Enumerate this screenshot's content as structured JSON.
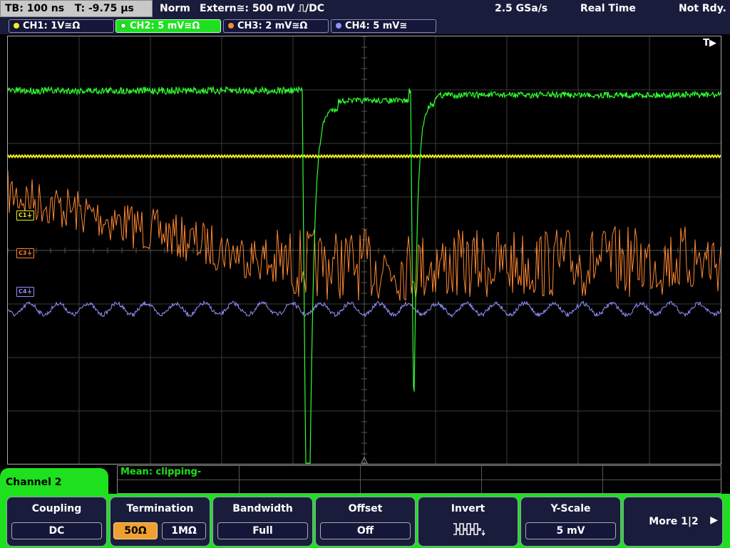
{
  "status": {
    "timebase": "TB: 100 ns",
    "trigger_time": "T: -9.75 µs",
    "mode": "Norm",
    "trigger_source": "Extern≅: 500 mV ⎍/DC",
    "sample_rate": "2.5 GSa/s",
    "acq_mode": "Real Time",
    "ready": "Not Rdy."
  },
  "channels": [
    {
      "label": "CH1: 1V≅Ω",
      "color": "#f0f020"
    },
    {
      "label": "CH2: 5 mV≅Ω",
      "color": "#30ff30"
    },
    {
      "label": "CH3: 2 mV≅Ω",
      "color": "#ff8830"
    },
    {
      "label": "CH4: 5 mV≅",
      "color": "#9090ff"
    }
  ],
  "markers": {
    "c1": "C1⏚",
    "c3": "C3⏚",
    "c4": "C4⏚",
    "trigger": "T▶"
  },
  "panel": {
    "title": "Channel 2",
    "mean": "Mean: clipping-"
  },
  "softkeys": {
    "coupling": {
      "title": "Coupling",
      "value": "DC"
    },
    "termination": {
      "title": "Termination",
      "opt1": "50Ω",
      "opt2": "1MΩ"
    },
    "bandwidth": {
      "title": "Bandwidth",
      "value": "Full"
    },
    "offset": {
      "title": "Offset",
      "value": "Off"
    },
    "invert": {
      "title": "Invert",
      "icon": "inverted-square-wave-icon"
    },
    "yscale": {
      "title": "Y-Scale",
      "value": "5 mV"
    },
    "more": {
      "label": "More 1|2",
      "icon": "right-arrow-icon"
    }
  }
}
